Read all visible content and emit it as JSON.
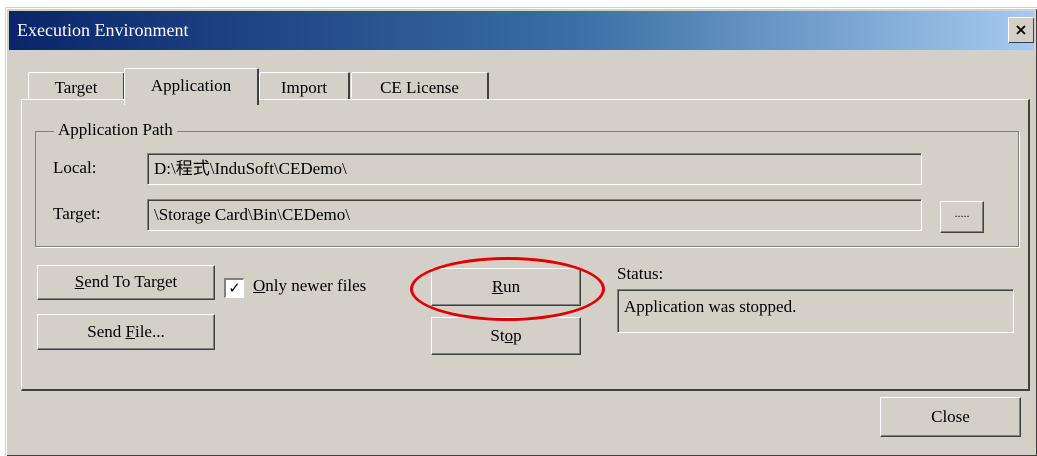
{
  "window": {
    "title": "Execution Environment",
    "close_glyph": "×"
  },
  "tabs": [
    {
      "label": "Target",
      "active": false
    },
    {
      "label": "Application",
      "active": true
    },
    {
      "label": "Import",
      "active": false
    },
    {
      "label": "CE License",
      "active": false
    }
  ],
  "app_path": {
    "legend": "Application Path",
    "local_label": "Local:",
    "local_value": "D:\\程式\\InduSoft\\CEDemo\\",
    "target_label": "Target:",
    "target_value": "\\Storage Card\\Bin\\CEDemo\\",
    "browse_label": "....."
  },
  "actions": {
    "send_to_target": {
      "mnemonic": "S",
      "rest": "end To Target"
    },
    "only_newer": {
      "mnemonic": "O",
      "rest": "nly newer files",
      "checked": true,
      "check_glyph": "✓"
    },
    "send_file": {
      "pre": "Send ",
      "mnemonic": "F",
      "rest": "ile..."
    },
    "run": {
      "mnemonic": "R",
      "rest": "un"
    },
    "stop": {
      "pre": "St",
      "mnemonic": "o",
      "rest": "p"
    }
  },
  "status": {
    "label": "Status:",
    "value": "Application was stopped."
  },
  "footer": {
    "close_label": "Close"
  },
  "colors": {
    "face": "#d4d0c8",
    "title_start": "#0a246a",
    "title_end": "#a6caf0",
    "highlight_ring": "#e00000"
  }
}
